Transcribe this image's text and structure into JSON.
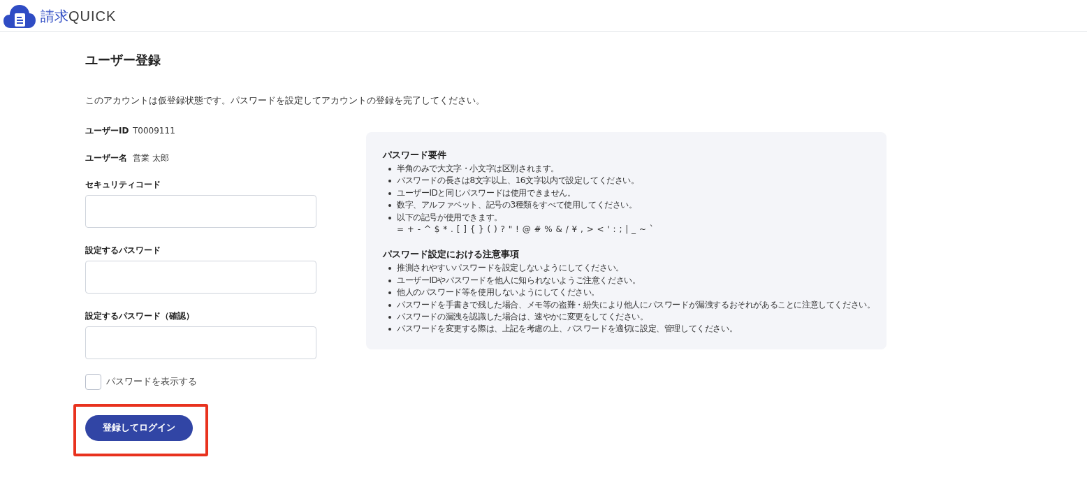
{
  "header": {
    "logo": {
      "text_primary": "請求",
      "text_secondary": "QUICK"
    }
  },
  "page": {
    "title": "ユーザー登録",
    "description": "このアカウントは仮登録状態です。パスワードを設定してアカウントの登録を完了してください。"
  },
  "account_info": [
    {
      "label": "ユーザーID",
      "value": "T0009111"
    },
    {
      "label": "ユーザー名",
      "value": "営業 太郎"
    }
  ],
  "fields": [
    {
      "label": "セキュリティコード"
    },
    {
      "label": "設定するパスワード"
    },
    {
      "label": "設定するパスワード（確認）"
    }
  ],
  "show_password": {
    "label": "パスワードを表示する",
    "checked": false
  },
  "submit_button": {
    "label": "登録してログイン",
    "highlighted": true
  },
  "info_panel": {
    "sections": [
      {
        "title": "パスワード要件",
        "items": [
          {
            "text": "半角のみで大文字・小文字は区別されます。"
          },
          {
            "text": "パスワードの長さは8文字以上、16文字以内で設定してください。"
          },
          {
            "text": "ユーザーIDと同じパスワードは使用できません。"
          },
          {
            "text": "数字、アルファベット、記号の3種類をすべて使用してください。"
          },
          {
            "text": "以下の記号が使用できます。",
            "detail": "= + - ^ $ * . [ ] { } ( ) ? \" ! @ # % & / ¥ , > < ' : ; | _ ~ `"
          }
        ]
      },
      {
        "title": "パスワード設定における注意事項",
        "items": [
          {
            "text": "推測されやすいパスワードを設定しないようにしてください。"
          },
          {
            "text": "ユーザーIDやパスワードを他人に知られないようご注意ください。"
          },
          {
            "text": "他人のパスワード等を使用しないようにしてください。"
          },
          {
            "text": "パスワードを手書きで残した場合、メモ等の盗難・紛失により他人にパスワードが漏洩するおそれがあることに注意してください。"
          },
          {
            "text": "パスワードの漏洩を認識した場合は、速やかに変更をしてください。"
          },
          {
            "text": "パスワードを変更する際は、上記を考慮の上、パスワードを適切に設定、管理してください。"
          }
        ]
      }
    ]
  }
}
